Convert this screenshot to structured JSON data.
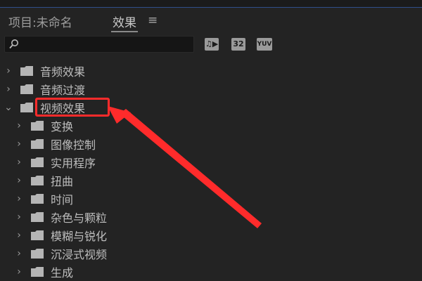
{
  "panel": {
    "project_tab": "项目:未命名",
    "effects_tab": "效果",
    "menu_icon": "≡"
  },
  "search": {
    "placeholder": "",
    "value": ""
  },
  "filters": {
    "accelerated": "♫▶",
    "bit32": "32",
    "yuv": "YUV"
  },
  "tree": {
    "items": [
      {
        "label": "音频效果",
        "expanded": false
      },
      {
        "label": "音频过渡",
        "expanded": false
      },
      {
        "label": "视频效果",
        "expanded": true
      },
      {
        "label": "变换",
        "expanded": false
      },
      {
        "label": "图像控制",
        "expanded": false
      },
      {
        "label": "实用程序",
        "expanded": false
      },
      {
        "label": "扭曲",
        "expanded": false
      },
      {
        "label": "时间",
        "expanded": false
      },
      {
        "label": "杂色与颗粒",
        "expanded": false
      },
      {
        "label": "模糊与锐化",
        "expanded": false
      },
      {
        "label": "沉浸式视频",
        "expanded": false
      },
      {
        "label": "生成",
        "expanded": false
      }
    ]
  },
  "annotation": {
    "color": "#ff2b2b"
  }
}
